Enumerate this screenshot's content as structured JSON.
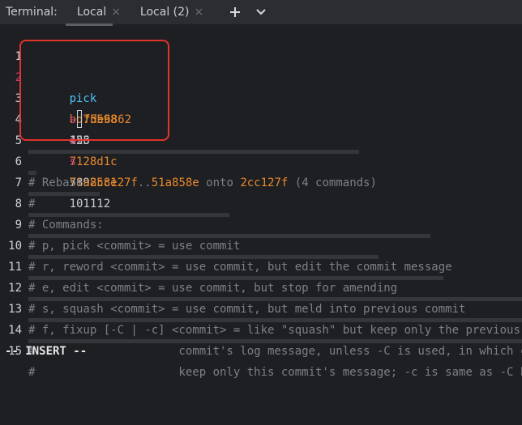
{
  "tabbar": {
    "title": "Terminal:",
    "tabs": [
      {
        "label": "Local",
        "close": "×"
      },
      {
        "label": "Local (2)",
        "close": "×"
      }
    ],
    "new_tab_icon": "plus-icon",
    "dropdown_icon": "chevron-down-icon"
  },
  "editor": {
    "lines": [
      {
        "num": "1",
        "cmd": "pick",
        "hash": "bd75598",
        "msg": "123"
      },
      {
        "num": "2",
        "cmd": "s",
        "hash": "fde6862",
        "msg": "456"
      },
      {
        "num": "3",
        "cmd": "s",
        "hash": "7128d1c",
        "msg": "789"
      },
      {
        "num": "4",
        "cmd": "s",
        "hash": "51a858e",
        "msg": "101112"
      },
      {
        "num": "5"
      },
      {
        "num": "6",
        "c1": "# Rebase ",
        "h1": "2cc127f",
        "c2": "..",
        "h2": "51a858e",
        "c3": " onto ",
        "h3": "2cc127f",
        "c4": " (4 commands)"
      },
      {
        "num": "7",
        "text": "#"
      },
      {
        "num": "8",
        "text": "# Commands:"
      },
      {
        "num": "9",
        "text": "# p, pick <commit> = use commit"
      },
      {
        "num": "10",
        "text": "# r, reword <commit> = use commit, but edit the commit message"
      },
      {
        "num": "11",
        "text": "# e, edit <commit> = use commit, but stop for amending"
      },
      {
        "num": "12",
        "text": "# s, squash <commit> = use commit, but meld into previous commit"
      },
      {
        "num": "13",
        "text": "# f, fixup [-C | -c] <commit> = like \"squash\" but keep only the previous"
      },
      {
        "num": "14",
        "text": "#                     commit's log message, unless -C is used, in which case"
      },
      {
        "num": "15",
        "text": "#                     keep only this commit's message; -c is same as -C but"
      }
    ]
  },
  "status": {
    "mode": "-- INSERT --"
  },
  "colors": {
    "highlight_box": "#e2332b",
    "pick": "#4fc3f7",
    "squash": "#cc3a7a",
    "hash": "#e8892d"
  }
}
